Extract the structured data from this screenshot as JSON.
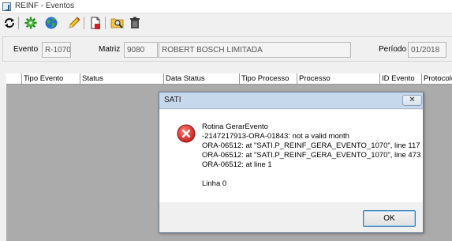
{
  "window": {
    "title": "REINF - Eventos"
  },
  "toolbar": {
    "icons": [
      "refresh-icon",
      "gear-icon",
      "globe-icon",
      "pencil-icon",
      "new-document-icon",
      "search-folder-icon",
      "trash-icon"
    ]
  },
  "header": {
    "evento_label": "Evento",
    "evento_value": "R-1070",
    "matriz_label": "Matriz",
    "matriz_code": "9080",
    "matriz_name": "ROBERT BOSCH LIMITADA",
    "periodo_label": "Período",
    "periodo_value": "01/2018"
  },
  "grid": {
    "columns": [
      "",
      "Tipo Evento",
      "Status",
      "Data Status",
      "Tipo Processo",
      "Processo",
      "ID Evento",
      "Protocolo"
    ],
    "rows": []
  },
  "dialog": {
    "title": "SATI",
    "close_label": "✕",
    "message_lines": [
      "Rotina GerarEvento",
      "-2147217913-ORA-01843: not a valid month",
      "ORA-06512: at \"SATI.P_REINF_GERA_EVENTO_1070\", line 117",
      "ORA-06512: at \"SATI.P_REINF_GERA_EVENTO_1070\", line 473",
      "ORA-06512: at line 1",
      "",
      "Linha 0"
    ],
    "ok_label": "OK",
    "error_color": "#d42a2a"
  }
}
